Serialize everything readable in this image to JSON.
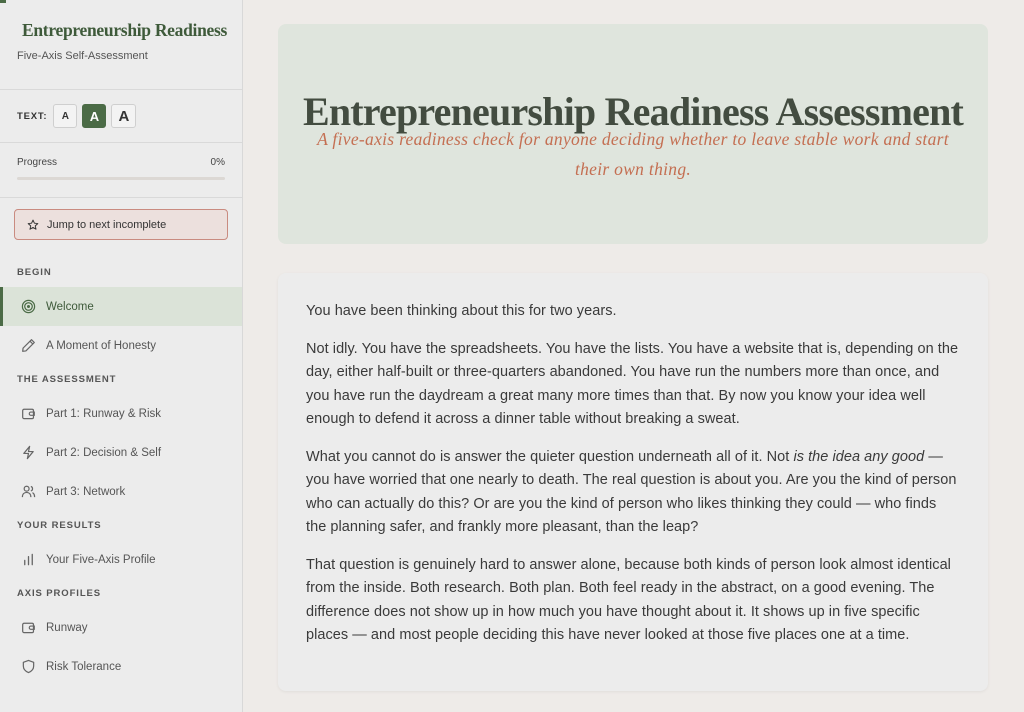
{
  "sidebar": {
    "brand_title": "Entrepreneurship Readiness",
    "brand_subtitle": "Five-Axis Self-Assessment",
    "text_size": {
      "label": "TEXT:",
      "small": "A",
      "medium": "A",
      "large": "A",
      "selected": "medium"
    },
    "progress": {
      "label": "Progress",
      "value_text": "0%",
      "value": 0
    },
    "jump_label": "Jump to next incomplete",
    "sections": {
      "begin": "BEGIN",
      "assessment": "THE ASSESSMENT",
      "results": "YOUR RESULTS",
      "profiles": "AXIS PROFILES"
    },
    "items": {
      "welcome": "Welcome",
      "honesty": "A Moment of Honesty",
      "part1": "Part 1: Runway & Risk",
      "part2": "Part 2: Decision & Self",
      "part3": "Part 3: Network",
      "profile": "Your Five-Axis Profile",
      "runway": "Runway",
      "risk": "Risk Tolerance"
    }
  },
  "hero": {
    "title": "Entrepreneurship Readiness Assessment",
    "subtitle": "A five-axis readiness check for anyone deciding whether to leave stable work and start their own thing."
  },
  "intro": {
    "p1": "You have been thinking about this for two years.",
    "p2": "Not idly. You have the spreadsheets. You have the lists. You have a website that is, depending on the day, either half-built or three-quarters abandoned. You have run the numbers more than once, and you have run the daydream a great many more times than that. By now you know your idea well enough to defend it across a dinner table without breaking a sweat.",
    "p3_a": "What you cannot do is answer the quieter question underneath all of it. Not ",
    "p3_em": "is the idea any good",
    "p3_b": " — you have worried that one nearly to death. The real question is about you. Are you the kind of person who can actually do this? Or are you the kind of person who likes thinking they could — who finds the planning safer, and frankly more pleasant, than the leap?",
    "p4": "That question is genuinely hard to answer alone, because both kinds of person look almost identical from the inside. Both research. Both plan. Both feel ready in the abstract, on a good evening. The difference does not show up in how much you have thought about it. It shows up in five specific places — and most people deciding this have never looked at those five places one at a time."
  },
  "colors": {
    "accent": "#4b6b46",
    "subtitle": "#c46f52",
    "hero_bg": "#dfe5dd"
  }
}
